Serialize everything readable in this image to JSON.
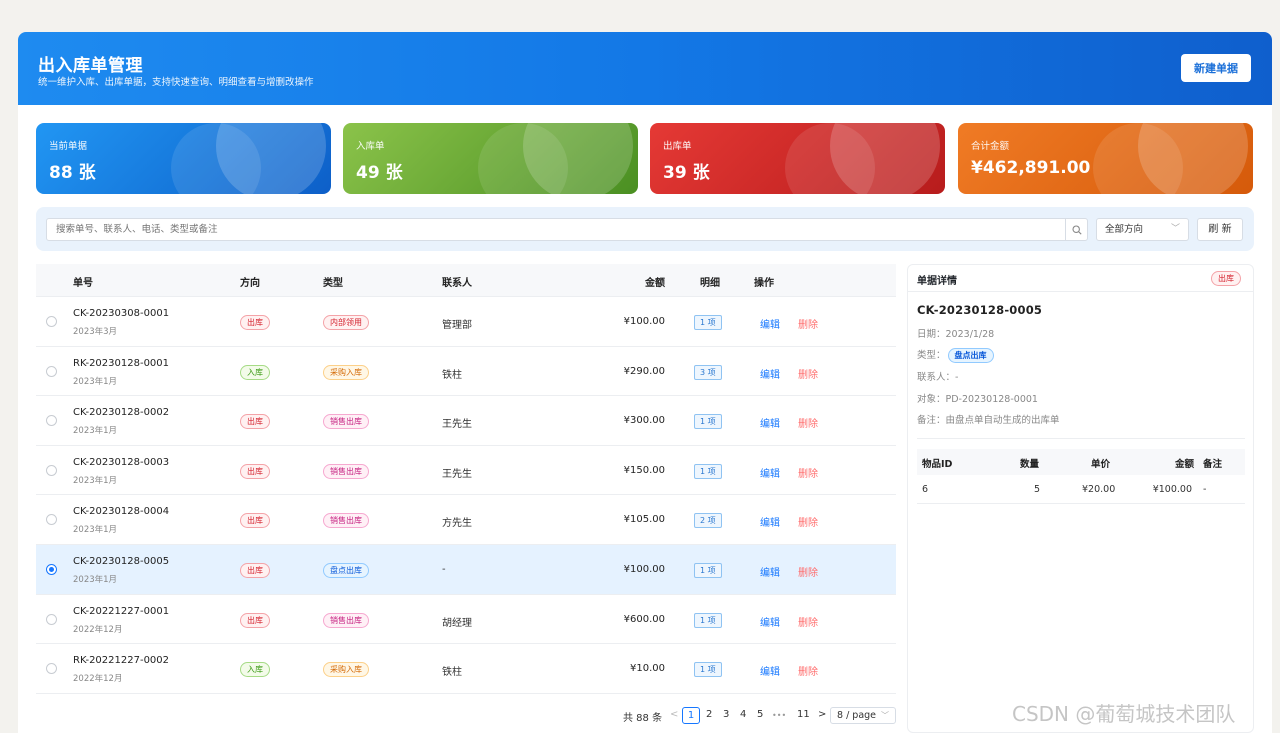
{
  "header": {
    "title": "出入库单管理",
    "subtitle": "统一维护入库、出库单据，支持快速查询、明细查看与增删改操作",
    "new_button": "新建单据"
  },
  "stats": [
    {
      "label": "当前单据",
      "value": "88 张"
    },
    {
      "label": "入库单",
      "value": "49 张"
    },
    {
      "label": "出库单",
      "value": "39 张"
    },
    {
      "label": "合计金额",
      "value": "¥462,891.00"
    }
  ],
  "search": {
    "placeholder": "搜索单号、联系人、电话、类型或备注",
    "direction_select": "全部方向",
    "refresh": "刷 新"
  },
  "table": {
    "columns": {
      "no": "单号",
      "direction": "方向",
      "type": "类型",
      "contact": "联系人",
      "amount": "金额",
      "items": "明细",
      "actions": "操作"
    },
    "rows": [
      {
        "no": "CK-20230308-0001",
        "date": "2023年3月",
        "direction": "出库",
        "type": "内部领用",
        "contact": "管理部",
        "amount": "¥100.00",
        "items": "1 项",
        "edit": "编辑",
        "del": "删除"
      },
      {
        "no": "RK-20230128-0001",
        "date": "2023年1月",
        "direction": "入库",
        "type": "采购入库",
        "contact": "铁柱",
        "amount": "¥290.00",
        "items": "3 项",
        "edit": "编辑",
        "del": "删除"
      },
      {
        "no": "CK-20230128-0002",
        "date": "2023年1月",
        "direction": "出库",
        "type": "销售出库",
        "contact": "王先生",
        "amount": "¥300.00",
        "items": "1 项",
        "edit": "编辑",
        "del": "删除"
      },
      {
        "no": "CK-20230128-0003",
        "date": "2023年1月",
        "direction": "出库",
        "type": "销售出库",
        "contact": "王先生",
        "amount": "¥150.00",
        "items": "1 项",
        "edit": "编辑",
        "del": "删除"
      },
      {
        "no": "CK-20230128-0004",
        "date": "2023年1月",
        "direction": "出库",
        "type": "销售出库",
        "contact": "方先生",
        "amount": "¥105.00",
        "items": "2 项",
        "edit": "编辑",
        "del": "删除"
      },
      {
        "no": "CK-20230128-0005",
        "date": "2023年1月",
        "direction": "出库",
        "type": "盘点出库",
        "contact": "-",
        "amount": "¥100.00",
        "items": "1 项",
        "edit": "编辑",
        "del": "删除"
      },
      {
        "no": "CK-20221227-0001",
        "date": "2022年12月",
        "direction": "出库",
        "type": "销售出库",
        "contact": "胡经理",
        "amount": "¥600.00",
        "items": "1 项",
        "edit": "编辑",
        "del": "删除"
      },
      {
        "no": "RK-20221227-0002",
        "date": "2022年12月",
        "direction": "入库",
        "type": "采购入库",
        "contact": "铁柱",
        "amount": "¥10.00",
        "items": "1 项",
        "edit": "编辑",
        "del": "删除"
      }
    ]
  },
  "pagination": {
    "total": "共 88 条",
    "prev": "<",
    "pages": [
      "1",
      "2",
      "3",
      "4",
      "5"
    ],
    "ellipsis": "•••",
    "last": "11",
    "next": ">",
    "page_size": "8 / page"
  },
  "detail": {
    "title": "单据详情",
    "direction": "出库",
    "code": "CK-20230128-0005",
    "date_label": "日期：",
    "date": "2023/1/28",
    "type_label": "类型：",
    "type": "盘点出库",
    "contact_label": "联系人：",
    "contact": "-",
    "target_label": "对象：",
    "target": "PD-20230128-0001",
    "remark_label": "备注：",
    "remark": "由盘点单自动生成的出库单",
    "items_columns": {
      "item_id": "物品ID",
      "qty": "数量",
      "price": "单价",
      "amount": "金额",
      "remark": "备注"
    },
    "items": [
      {
        "item_id": "6",
        "qty": "5",
        "price": "¥20.00",
        "amount": "¥100.00",
        "remark": "-"
      }
    ]
  },
  "watermark": "CSDN @葡萄城技术团队",
  "colors": {
    "primary": "#1677ff",
    "header": "#1378e6",
    "card_blue": "#2196f3",
    "card_green": "#8bc34a",
    "card_red": "#e53935",
    "card_orange": "#f07b25"
  }
}
